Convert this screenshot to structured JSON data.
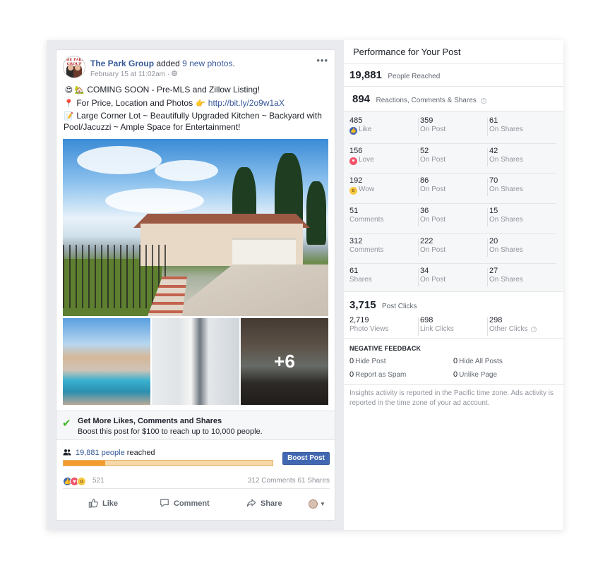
{
  "post": {
    "page_name": "The Park Group",
    "action_text": "added",
    "photos_link": "9 new photos",
    "period": ".",
    "timestamp": "February 15 at 11:02am",
    "audience_separator": "·",
    "avatar_logo_text": "THE PARK GROUP",
    "more_label": "•••",
    "line1": "COMING SOON - Pre-MLS and Zillow Listing!",
    "line2": "For Price, Location and Photos",
    "line2_link": "http://bit.ly/2o9w1aX",
    "line3": "Large Corner Lot ~ Beautifully Upgraded Kitchen ~ Backyard with Pool/Jacuzzi ~ Ample Space for Entertainment!",
    "emoji": {
      "l1a": "😍",
      "l1b": "🏡",
      "l2a": "📍",
      "l2b": "👉",
      "l3a": "📝"
    },
    "more_photos_label": "+6",
    "boost_title": "Get More Likes, Comments and Shares",
    "boost_sub": "Boost this post for $100 to reach up to 10,000 people.",
    "reach_count_link": "19,881 people",
    "reach_suffix": "reached",
    "reach_fraction": 0.2,
    "boost_button": "Boost Post",
    "reaction_total": "521",
    "comments_shares": "312 Comments  61 Shares",
    "actions": {
      "like": "Like",
      "comment": "Comment",
      "share": "Share"
    },
    "icons": {
      "verified": "check-icon",
      "people": "people-icon",
      "like": "thumbs-up-icon",
      "comment": "comment-bubble-icon",
      "share": "share-arrow-icon"
    }
  },
  "insights": {
    "title": "Performance for Your Post",
    "reach_num": "19,881",
    "reach_label": "People Reached",
    "engagement_num": "894",
    "engagement_label": "Reactions, Comments & Shares",
    "metrics": [
      [
        {
          "n": "485",
          "l": "Like",
          "icon": "like"
        },
        {
          "n": "359",
          "l": "On Post"
        },
        {
          "n": "61",
          "l": "On Shares"
        }
      ],
      [
        {
          "n": "156",
          "l": "Love",
          "icon": "love"
        },
        {
          "n": "52",
          "l": "On Post"
        },
        {
          "n": "42",
          "l": "On Shares"
        }
      ],
      [
        {
          "n": "192",
          "l": "Wow",
          "icon": "wow"
        },
        {
          "n": "86",
          "l": "On Post"
        },
        {
          "n": "70",
          "l": "On Shares"
        }
      ],
      [
        {
          "n": "51",
          "l": "Comments"
        },
        {
          "n": "36",
          "l": "On Post"
        },
        {
          "n": "15",
          "l": "On Shares"
        }
      ],
      [
        {
          "n": "312",
          "l": "Comments"
        },
        {
          "n": "222",
          "l": "On Post"
        },
        {
          "n": "20",
          "l": "On Shares"
        }
      ],
      [
        {
          "n": "61",
          "l": "Shares"
        },
        {
          "n": "34",
          "l": "On Post"
        },
        {
          "n": "27",
          "l": "On Shares"
        }
      ]
    ],
    "clicks_num": "3,715",
    "clicks_label": "Post Clicks",
    "photo_views_num": "2,719",
    "photo_views_label": "Photo Views",
    "link_clicks_num": "698",
    "link_clicks_label": "Link Clicks",
    "other_clicks_num": "298",
    "other_clicks_label": "Other Clicks",
    "negative_title": "NEGATIVE FEEDBACK",
    "negative": [
      {
        "n": "0",
        "l": "Hide Post"
      },
      {
        "n": "0",
        "l": "Hide All Posts"
      },
      {
        "n": "0",
        "l": "Report as Spam"
      },
      {
        "n": "0",
        "l": "Unlike Page"
      }
    ],
    "footnote": "Insights activity is reported in the Pacific time zone. Ads activity is reported in the time zone of your ad account."
  },
  "colors": {
    "link": "#365899",
    "boost_button": "#4267b2",
    "reach_bar": "#f39c2d",
    "like": "#4267b2",
    "love": "#f25268",
    "wow": "#f7c843"
  }
}
